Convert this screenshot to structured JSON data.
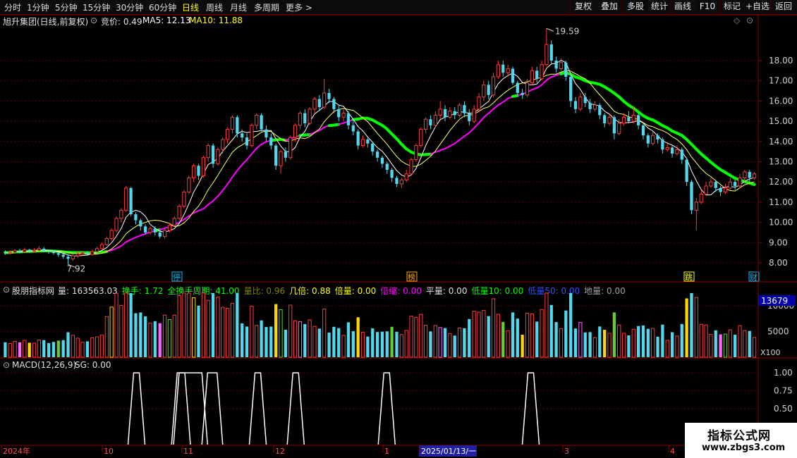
{
  "toolbar": {
    "timeframes": [
      "分时",
      "1分钟",
      "5分钟",
      "15分钟",
      "30分钟",
      "60分钟",
      "日线",
      "周线",
      "月线",
      "多周期",
      "更多 >"
    ],
    "active_timeframe": "日线",
    "right_buttons": [
      "复权",
      "叠加",
      "多股",
      "统计",
      "画线",
      "F10",
      "标记",
      "+自选",
      "返回"
    ]
  },
  "main_info": {
    "title": "旭升集团(日线,前复权)",
    "bid": "竞价: 0.49",
    "ma5": "MA5: 12.13",
    "ma10": "MA10: 11.88",
    "high_label": "19.59",
    "low_label": "7.92"
  },
  "markers": [
    "停",
    "榜",
    "跳",
    "财"
  ],
  "volume_info": {
    "name": "股朋指标网",
    "items": [
      {
        "text": "量: 163563.03",
        "color": "#e0e0e0"
      },
      {
        "text": "换手: 1.72",
        "color": "#00ff00"
      },
      {
        "text": "全换手周期: 41.00",
        "color": "#00ff00"
      },
      {
        "text": "量比: 0.96",
        "color": "#808000"
      },
      {
        "text": "几倍: 0.88",
        "color": "#ffff00"
      },
      {
        "text": "倍量: 0.00",
        "color": "#ffff00"
      },
      {
        "text": "倍缩: 0.00",
        "color": "#ff00ff"
      },
      {
        "text": "平量: 0.00",
        "color": "#e0e0e0"
      },
      {
        "text": "低量10: 0.00",
        "color": "#00ff00"
      },
      {
        "text": "低量50: 0.00",
        "color": "#3050ff"
      },
      {
        "text": "地量: 0.00",
        "color": "#a0a0a0"
      }
    ],
    "current_value": "13679",
    "unit": "X100"
  },
  "macd_info": {
    "name": "MACD(12,26,9)",
    "sg": "SG: 0.00"
  },
  "x_axis_labels": [
    "2024年",
    "10",
    "11",
    "12",
    "1",
    "2025/01/13/一",
    "3",
    "4"
  ],
  "watermark": {
    "line1": "指标公式网",
    "line2": "www.zbgs3.com"
  },
  "chart_data": [
    {
      "type": "candlestick",
      "y_axis_ticks": [
        8.0,
        9.0,
        10.0,
        11.0,
        12.0,
        13.0,
        14.0,
        15.0,
        16.0,
        17.0,
        18.0
      ],
      "ylim": [
        7.5,
        20.0
      ],
      "candles": [
        [
          8.55,
          8.5,
          8.62,
          8.4
        ],
        [
          8.5,
          8.52,
          8.62,
          8.42
        ],
        [
          8.52,
          8.6,
          8.68,
          8.45
        ],
        [
          8.6,
          8.55,
          8.7,
          8.48
        ],
        [
          8.55,
          8.65,
          8.75,
          8.5
        ],
        [
          8.65,
          8.58,
          8.7,
          8.5
        ],
        [
          8.58,
          8.62,
          8.72,
          8.52
        ],
        [
          8.62,
          8.7,
          8.82,
          8.55
        ],
        [
          8.7,
          8.6,
          8.78,
          8.52
        ],
        [
          8.6,
          8.55,
          8.65,
          8.45
        ],
        [
          8.55,
          8.48,
          8.62,
          8.4
        ],
        [
          8.48,
          8.4,
          8.55,
          8.3
        ],
        [
          8.4,
          8.3,
          8.45,
          8.2
        ],
        [
          8.3,
          8.2,
          8.38,
          7.92
        ],
        [
          8.2,
          8.35,
          8.45,
          8.1
        ],
        [
          8.35,
          8.45,
          8.55,
          8.25
        ],
        [
          8.45,
          8.5,
          8.6,
          8.38
        ],
        [
          8.5,
          8.42,
          8.58,
          8.35
        ],
        [
          8.42,
          8.55,
          8.65,
          8.35
        ],
        [
          8.55,
          8.7,
          8.8,
          8.48
        ],
        [
          8.7,
          8.9,
          9.0,
          8.65
        ],
        [
          8.9,
          9.2,
          9.3,
          8.85
        ],
        [
          9.2,
          9.6,
          9.7,
          9.1
        ],
        [
          9.6,
          10.2,
          10.3,
          9.5
        ],
        [
          10.2,
          10.6,
          10.7,
          10.0
        ],
        [
          10.6,
          11.7,
          11.8,
          10.5
        ],
        [
          11.7,
          10.4,
          11.75,
          10.3
        ],
        [
          10.4,
          10.1,
          10.5,
          9.9
        ],
        [
          10.1,
          9.8,
          10.2,
          9.6
        ],
        [
          9.8,
          9.5,
          9.9,
          9.4
        ],
        [
          9.5,
          9.7,
          9.8,
          9.4
        ],
        [
          9.7,
          9.5,
          9.8,
          9.35
        ],
        [
          9.5,
          9.3,
          9.6,
          9.2
        ],
        [
          9.3,
          9.6,
          9.7,
          9.2
        ],
        [
          9.6,
          9.85,
          9.95,
          9.5
        ],
        [
          9.85,
          10.2,
          10.3,
          9.8
        ],
        [
          10.2,
          10.8,
          10.9,
          10.1
        ],
        [
          10.8,
          11.5,
          11.6,
          10.7
        ],
        [
          11.5,
          12.2,
          12.3,
          11.4
        ],
        [
          12.2,
          12.8,
          12.9,
          12.0
        ],
        [
          12.8,
          12.3,
          12.9,
          12.1
        ],
        [
          12.3,
          13.2,
          13.3,
          12.2
        ],
        [
          13.2,
          13.8,
          13.9,
          13.0
        ],
        [
          13.8,
          12.9,
          13.9,
          12.7
        ],
        [
          12.9,
          13.6,
          13.7,
          12.8
        ],
        [
          13.6,
          14.1,
          14.2,
          13.4
        ],
        [
          14.1,
          14.6,
          14.7,
          13.9
        ],
        [
          14.6,
          15.2,
          15.3,
          14.4
        ],
        [
          15.2,
          14.4,
          15.3,
          14.2
        ],
        [
          14.4,
          14.2,
          14.6,
          14.0
        ],
        [
          14.2,
          13.8,
          14.4,
          13.6
        ],
        [
          13.8,
          14.8,
          14.9,
          13.7
        ],
        [
          14.8,
          15.3,
          15.4,
          14.6
        ],
        [
          15.3,
          14.6,
          15.4,
          14.5
        ],
        [
          14.6,
          14.2,
          14.8,
          14.0
        ],
        [
          14.2,
          13.8,
          14.4,
          13.6
        ],
        [
          13.8,
          12.8,
          13.9,
          12.6
        ],
        [
          12.8,
          13.5,
          13.6,
          12.4
        ],
        [
          13.5,
          13.2,
          13.7,
          13.0
        ],
        [
          13.2,
          14.2,
          14.3,
          13.1
        ],
        [
          14.2,
          14.8,
          14.9,
          14.0
        ],
        [
          14.8,
          15.4,
          15.5,
          14.6
        ],
        [
          15.4,
          14.9,
          15.6,
          14.7
        ],
        [
          14.9,
          15.6,
          15.7,
          14.8
        ],
        [
          15.6,
          16.1,
          16.2,
          15.4
        ],
        [
          16.1,
          15.7,
          16.3,
          15.5
        ],
        [
          15.7,
          16.4,
          17.1,
          15.6
        ],
        [
          16.4,
          16.1,
          16.6,
          15.9
        ],
        [
          16.1,
          15.6,
          16.2,
          15.4
        ],
        [
          15.6,
          15.2,
          15.8,
          15.0
        ],
        [
          15.2,
          15.4,
          15.6,
          15.0
        ],
        [
          15.4,
          14.8,
          15.5,
          14.6
        ],
        [
          14.8,
          14.5,
          15.0,
          14.3
        ],
        [
          14.5,
          13.8,
          14.6,
          13.6
        ],
        [
          13.8,
          14.1,
          14.3,
          13.7
        ],
        [
          14.1,
          13.9,
          14.2,
          13.7
        ],
        [
          13.9,
          13.5,
          14.0,
          13.3
        ],
        [
          13.5,
          13.2,
          13.6,
          13.0
        ],
        [
          13.2,
          12.9,
          13.3,
          12.7
        ],
        [
          12.9,
          12.6,
          13.0,
          12.4
        ],
        [
          12.6,
          12.2,
          12.7,
          12.0
        ],
        [
          12.2,
          11.9,
          12.3,
          11.75
        ],
        [
          11.9,
          12.1,
          12.2,
          11.7
        ],
        [
          12.1,
          12.4,
          12.6,
          12.0
        ],
        [
          12.4,
          13.1,
          13.2,
          12.3
        ],
        [
          13.1,
          13.8,
          13.9,
          13.0
        ],
        [
          13.8,
          14.6,
          14.7,
          13.7
        ],
        [
          14.6,
          15.1,
          15.2,
          14.4
        ],
        [
          15.1,
          14.8,
          15.3,
          14.6
        ],
        [
          14.8,
          15.3,
          15.5,
          14.7
        ],
        [
          15.3,
          15.6,
          16.0,
          15.1
        ],
        [
          15.6,
          15.2,
          15.8,
          15.0
        ],
        [
          15.2,
          15.5,
          15.7,
          15.1
        ],
        [
          15.5,
          15.3,
          15.7,
          15.1
        ],
        [
          15.3,
          15.8,
          15.9,
          15.2
        ],
        [
          15.8,
          15.4,
          16.0,
          15.2
        ],
        [
          15.4,
          15.0,
          15.6,
          14.8
        ],
        [
          15.0,
          15.6,
          15.8,
          14.9
        ],
        [
          15.6,
          16.2,
          16.4,
          15.5
        ],
        [
          16.2,
          16.8,
          17.0,
          16.0
        ],
        [
          16.8,
          16.3,
          17.0,
          16.1
        ],
        [
          16.3,
          17.2,
          17.4,
          16.2
        ],
        [
          17.2,
          17.8,
          18.0,
          17.1
        ],
        [
          17.8,
          17.4,
          18.0,
          17.2
        ],
        [
          17.4,
          17.6,
          17.8,
          17.2
        ],
        [
          17.6,
          16.9,
          17.7,
          16.8
        ],
        [
          16.9,
          16.4,
          17.0,
          16.2
        ],
        [
          16.4,
          16.3,
          16.6,
          16.1
        ],
        [
          16.3,
          16.9,
          17.1,
          16.2
        ],
        [
          16.9,
          17.5,
          17.7,
          16.8
        ],
        [
          17.5,
          17.1,
          17.7,
          16.9
        ],
        [
          17.1,
          17.8,
          18.0,
          17.0
        ],
        [
          17.8,
          18.8,
          19.59,
          17.7
        ],
        [
          18.8,
          18.0,
          19.0,
          17.8
        ],
        [
          18.0,
          17.6,
          18.2,
          17.4
        ],
        [
          17.6,
          17.9,
          18.1,
          17.5
        ],
        [
          17.9,
          17.2,
          18.0,
          17.0
        ],
        [
          17.2,
          16.0,
          17.3,
          15.7
        ],
        [
          16.0,
          15.6,
          16.2,
          15.4
        ],
        [
          15.6,
          16.2,
          16.4,
          15.5
        ],
        [
          16.2,
          15.9,
          16.4,
          15.7
        ],
        [
          15.9,
          15.6,
          16.1,
          15.4
        ],
        [
          15.6,
          15.8,
          16.0,
          15.5
        ],
        [
          15.8,
          15.3,
          15.9,
          15.1
        ],
        [
          15.3,
          14.9,
          15.4,
          14.7
        ],
        [
          14.9,
          15.2,
          15.4,
          14.8
        ],
        [
          15.2,
          14.4,
          15.3,
          14.1
        ],
        [
          14.4,
          14.9,
          15.1,
          14.3
        ],
        [
          14.9,
          15.2,
          15.4,
          14.8
        ],
        [
          15.2,
          15.0,
          15.5,
          14.9
        ],
        [
          15.0,
          15.3,
          15.7,
          14.9
        ],
        [
          15.3,
          14.8,
          15.4,
          14.6
        ],
        [
          14.8,
          14.3,
          14.9,
          14.1
        ],
        [
          14.3,
          13.9,
          14.4,
          13.7
        ],
        [
          13.9,
          14.3,
          14.5,
          13.8
        ],
        [
          14.3,
          14.1,
          14.4,
          13.9
        ],
        [
          14.1,
          13.6,
          14.2,
          13.4
        ],
        [
          13.6,
          13.7,
          13.9,
          13.5
        ],
        [
          13.7,
          13.4,
          13.8,
          13.2
        ],
        [
          13.4,
          13.6,
          13.8,
          13.3
        ],
        [
          13.6,
          13.1,
          13.7,
          12.9
        ],
        [
          13.1,
          12.0,
          13.2,
          11.8
        ],
        [
          12.0,
          10.6,
          12.1,
          10.4
        ],
        [
          10.6,
          11.0,
          11.2,
          9.6
        ],
        [
          11.0,
          11.4,
          11.6,
          10.9
        ],
        [
          11.4,
          11.8,
          12.0,
          11.3
        ],
        [
          11.8,
          12.0,
          12.2,
          11.7
        ],
        [
          12.0,
          11.7,
          12.1,
          11.5
        ],
        [
          11.7,
          11.5,
          11.8,
          11.3
        ],
        [
          11.5,
          11.7,
          11.9,
          11.4
        ],
        [
          11.7,
          12.0,
          12.2,
          11.6
        ],
        [
          12.0,
          11.8,
          12.1,
          11.6
        ],
        [
          11.8,
          12.2,
          12.4,
          11.7
        ],
        [
          12.2,
          12.5,
          12.6,
          12.0
        ],
        [
          12.5,
          12.2,
          12.6,
          12.0
        ],
        [
          12.2,
          12.4,
          12.5,
          12.1
        ]
      ],
      "ma_long_color": "#00ff00"
    },
    {
      "type": "bar",
      "y_axis_ticks": [
        5000,
        10000
      ],
      "ylim": [
        0,
        14000
      ]
    },
    {
      "type": "line",
      "y_axis_ticks": [
        0.5,
        0.75,
        1.0
      ],
      "ylim": [
        0,
        1.1
      ],
      "pulses": [
        0.18,
        0.24,
        0.34,
        0.39,
        0.51,
        0.7
      ]
    }
  ]
}
